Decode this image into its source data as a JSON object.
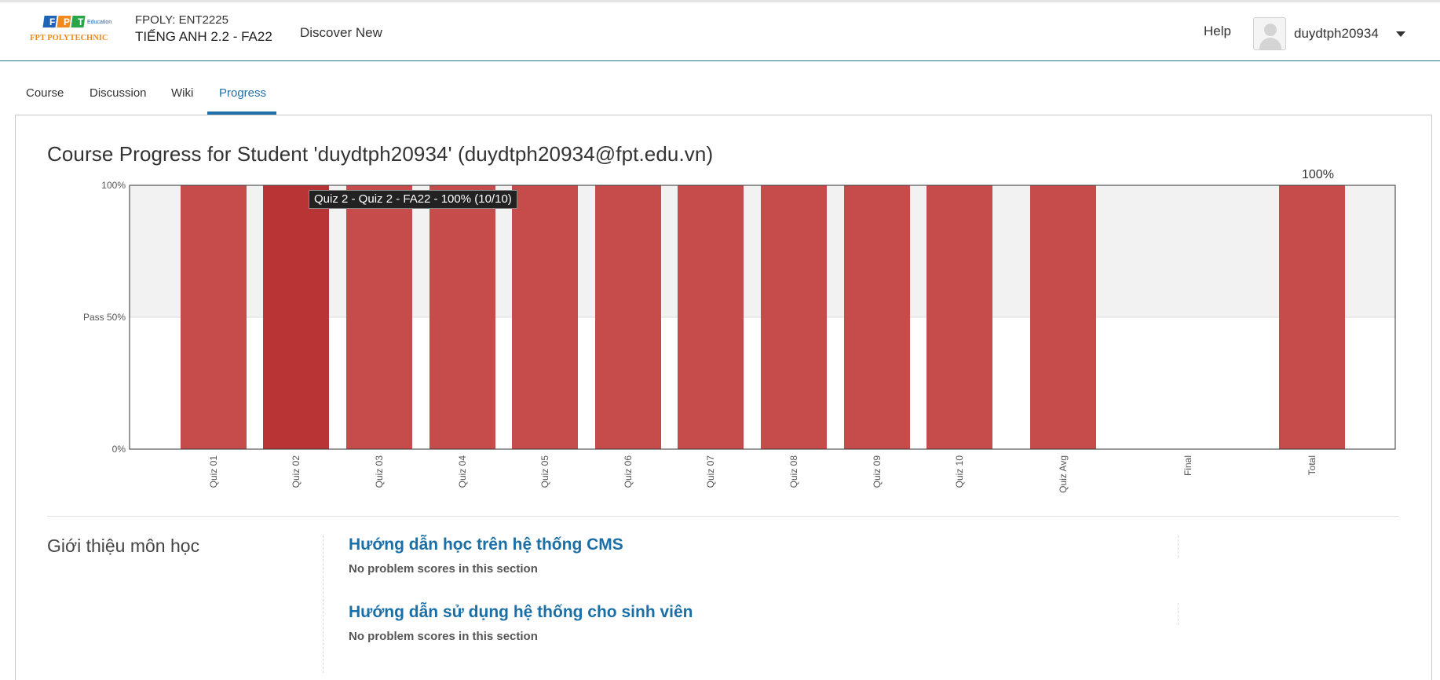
{
  "header": {
    "logo_text": "FPT POLYTECHNIC",
    "logo_sub": "Education",
    "course_org": "FPOLY: ENT2225",
    "course_name": "TIẾNG ANH 2.2 - FA22",
    "discover": "Discover New",
    "help": "Help",
    "username": "duydtph20934"
  },
  "tabs": [
    {
      "label": "Course"
    },
    {
      "label": "Discussion"
    },
    {
      "label": "Wiki"
    },
    {
      "label": "Progress",
      "active": true
    }
  ],
  "page": {
    "title": "Course Progress for Student 'duydtph20934' (duydtph20934@fpt.edu.vn)"
  },
  "tooltip": "Quiz 2 - Quiz 2 - FA22 - 100% (10/10)",
  "chart_data": {
    "type": "bar",
    "categories": [
      "Quiz 01",
      "Quiz 02",
      "Quiz 03",
      "Quiz 04",
      "Quiz 05",
      "Quiz 06",
      "Quiz 07",
      "Quiz 08",
      "Quiz 09",
      "Quiz 10",
      "Quiz Avg",
      "Final",
      "Total"
    ],
    "values": [
      100,
      100,
      100,
      100,
      100,
      100,
      100,
      100,
      100,
      100,
      100,
      0,
      100
    ],
    "y_ticks": [
      "0%",
      "Pass 50%",
      "100%"
    ],
    "ylim": [
      0,
      100
    ],
    "pass_threshold": 50,
    "total_label": "100%",
    "bar_color": "#c64c4c",
    "highlight_color": "#b93535",
    "highlight_index": 1
  },
  "chapters": [
    {
      "title": "Giới thiệu môn học",
      "sections": [
        {
          "title": "Hướng dẫn học trên hệ thống CMS",
          "note": "No problem scores in this section"
        },
        {
          "title": "Hướng dẫn sử dụng hệ thống cho sinh viên",
          "note": "No problem scores in this section"
        }
      ]
    }
  ]
}
